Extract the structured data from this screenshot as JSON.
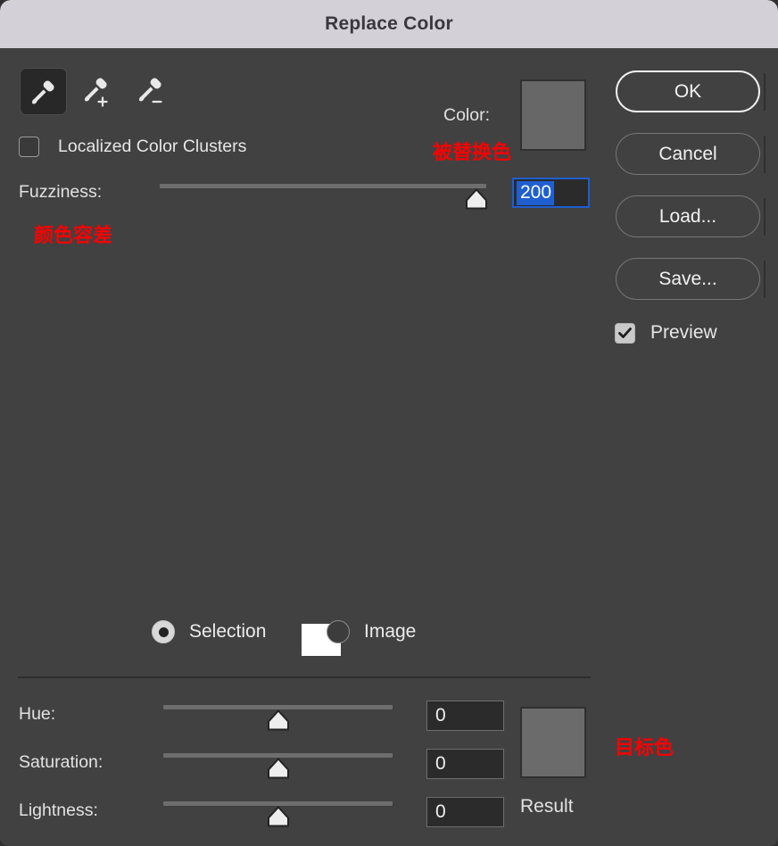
{
  "window": {
    "title": "Replace Color"
  },
  "tools": {
    "eyedropper": "eyedropper-icon",
    "eyedropper_add": "eyedropper-plus-icon",
    "eyedropper_subtract": "eyedropper-minus-icon",
    "selected": "eyedropper"
  },
  "options": {
    "localized_color_clusters": {
      "label": "Localized Color Clusters",
      "checked": false
    },
    "preview": {
      "label": "Preview",
      "checked": true
    }
  },
  "source_color": {
    "label": "Color:",
    "swatch_hex": "#676767",
    "annotation": "被替换色"
  },
  "fuzziness": {
    "label": "Fuzziness:",
    "value": "200",
    "annotation": "颜色容差",
    "min": 0,
    "max": 200,
    "handle_percent": 97
  },
  "display_mode": {
    "options": [
      {
        "label": "Selection",
        "selected": true
      },
      {
        "label": "Image",
        "selected": false
      }
    ]
  },
  "adjustments": [
    {
      "name": "hue",
      "label": "Hue:",
      "value": "0",
      "handle_percent": 50
    },
    {
      "name": "saturation",
      "label": "Saturation:",
      "value": "0",
      "handle_percent": 50
    },
    {
      "name": "lightness",
      "label": "Lightness:",
      "value": "0",
      "handle_percent": 50
    }
  ],
  "result": {
    "label": "Result",
    "swatch_hex": "#6b6b6b",
    "annotation": "目标色"
  },
  "buttons": [
    {
      "name": "ok",
      "label": "OK",
      "style": "default"
    },
    {
      "name": "cancel",
      "label": "Cancel",
      "style": "normal"
    },
    {
      "name": "load",
      "label": "Load...",
      "style": "normal"
    },
    {
      "name": "save",
      "label": "Save...",
      "style": "normal"
    }
  ],
  "colors": {
    "dialog_bg": "#414141",
    "titlebar_bg": "#d3d0d7",
    "accent_blue": "#1f5fd0",
    "annotation_red": "#fa0000"
  }
}
